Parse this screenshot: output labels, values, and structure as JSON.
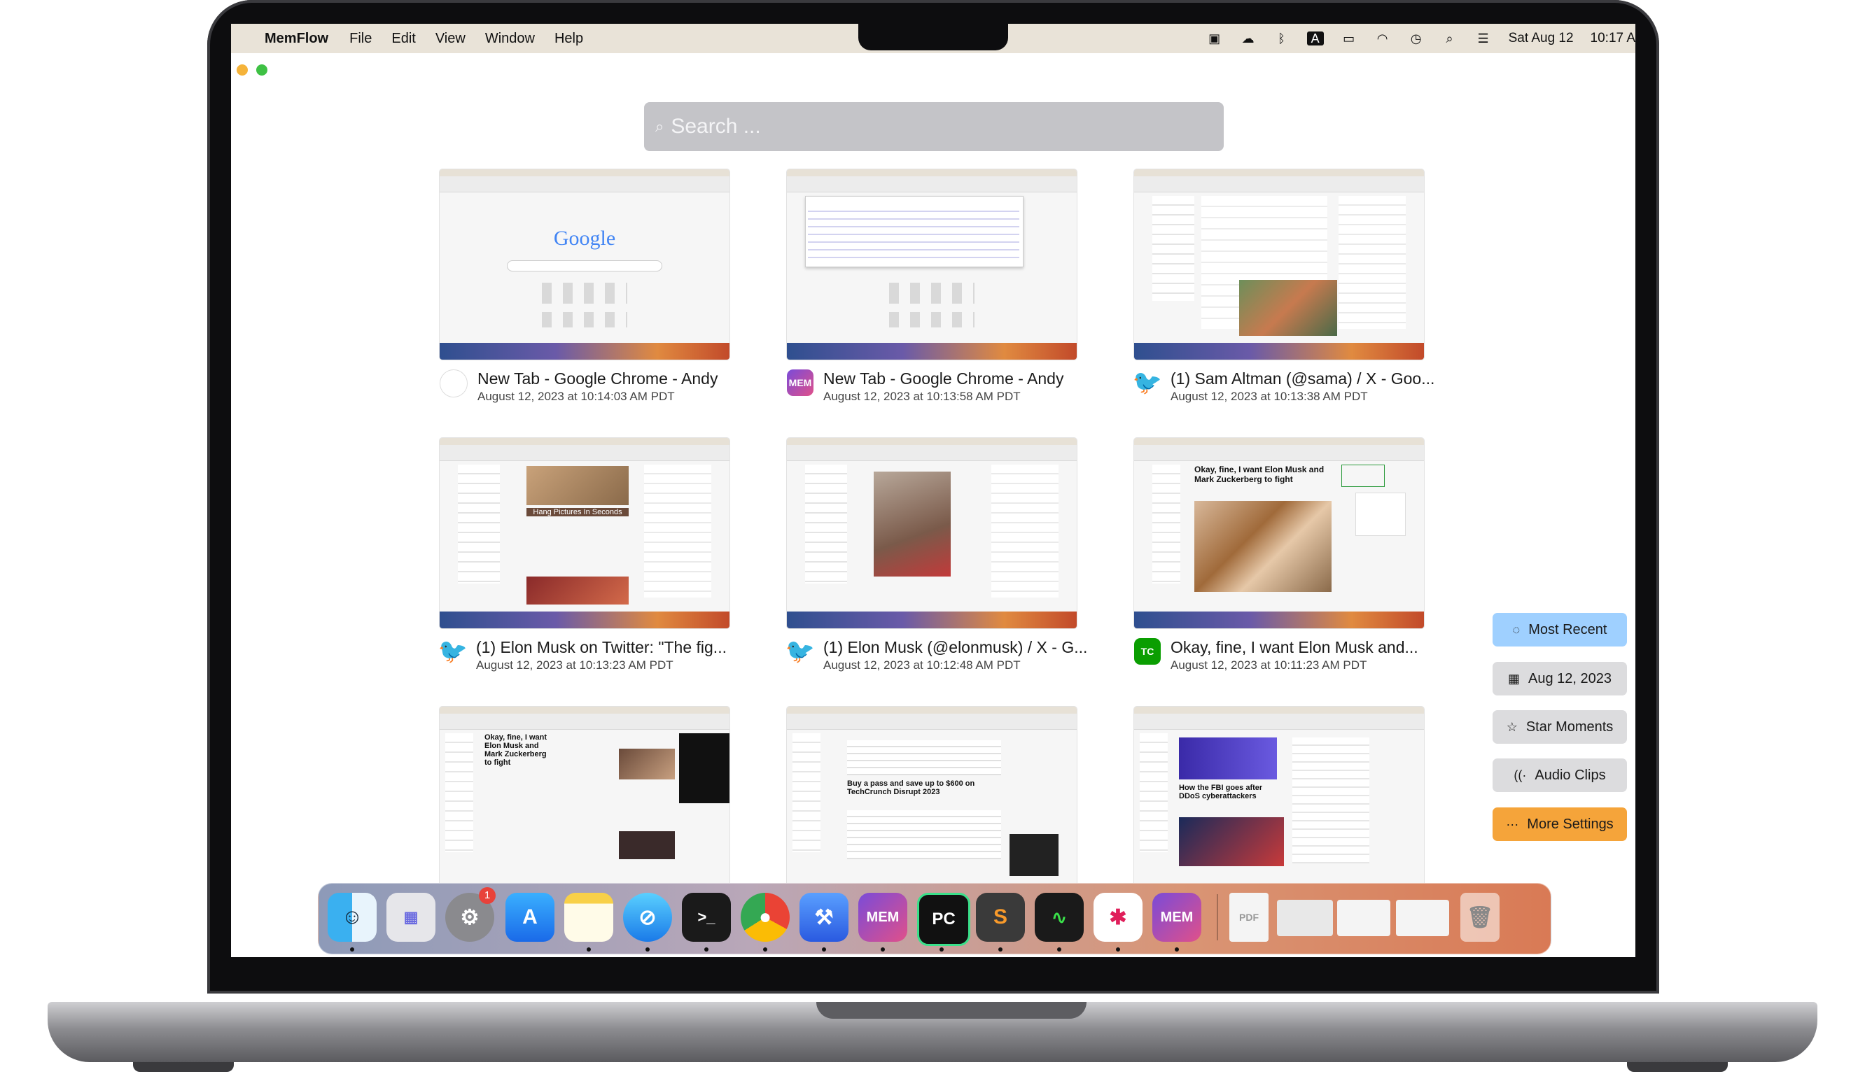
{
  "menubar": {
    "app_name": "MemFlow",
    "menus": [
      "File",
      "Edit",
      "View",
      "Window",
      "Help"
    ],
    "date": "Sat Aug 12",
    "time": "10:17 A"
  },
  "search": {
    "placeholder": "Search ..."
  },
  "cards": [
    {
      "title": "New Tab - Google Chrome - Andy",
      "date": "August 12, 2023 at 10:14:03 AM PDT",
      "app_icon": "apple-icon",
      "thumb_text": "Google"
    },
    {
      "title": "New Tab - Google Chrome - Andy",
      "date": "August 12, 2023 at 10:13:58 AM PDT",
      "app_icon": "mem-icon",
      "app_label": "MEM"
    },
    {
      "title": "(1) Sam Altman (@sama) / X - Goo...",
      "date": "August 12, 2023 at 10:13:38 AM PDT",
      "app_icon": "twitter-icon"
    },
    {
      "title": "(1) Elon Musk on Twitter: \"The fig...",
      "date": "August 12, 2023 at 10:13:23 AM PDT",
      "app_icon": "twitter-icon",
      "thumb_text": "Hang Pictures In Seconds"
    },
    {
      "title": "(1) Elon Musk (@elonmusk) / X - G...",
      "date": "August 12, 2023 at 10:12:48 AM PDT",
      "app_icon": "twitter-icon"
    },
    {
      "title": "Okay, fine, I want Elon Musk and...",
      "date": "August 12, 2023 at 10:11:23 AM PDT",
      "app_icon": "techcrunch-icon",
      "app_label": "TC",
      "thumb_text": "Okay, fine, I want Elon Musk and Mark Zuckerberg to fight"
    },
    {
      "title": "",
      "date": "",
      "app_icon": "",
      "thumb_text": "Okay, fine, I want Elon Musk and Mark Zuckerberg to fight"
    },
    {
      "title": "",
      "date": "",
      "app_icon": "",
      "thumb_text": "Buy a pass and save up to $600 on TechCrunch Disrupt 2023"
    },
    {
      "title": "",
      "date": "",
      "app_icon": "",
      "thumb_text": "How the FBI goes after DDoS cyberattackers"
    }
  ],
  "sidebar": {
    "buttons": [
      {
        "label": "Most Recent",
        "icon": "circle-icon",
        "color": "#9fd0ff"
      },
      {
        "label": "Aug 12, 2023",
        "icon": "calendar-icon",
        "color": "#dcdcde"
      },
      {
        "label": "Star Moments",
        "icon": "star-icon",
        "color": "#dcdcde"
      },
      {
        "label": "Audio Clips",
        "icon": "audio-icon",
        "color": "#dcdcde"
      },
      {
        "label": "More Settings",
        "icon": "ellipsis-icon",
        "color": "#f5a43a"
      }
    ]
  },
  "dock": {
    "notifications_badge": "1",
    "apps": [
      "Finder",
      "Launchpad",
      "System Settings",
      "App Store",
      "Notes",
      "Safari",
      "Terminal",
      "Chrome",
      "Xcode",
      "MEM",
      "PyCharm",
      "Sublime Text",
      "Activity Monitor",
      "Slack",
      "MEM"
    ]
  }
}
